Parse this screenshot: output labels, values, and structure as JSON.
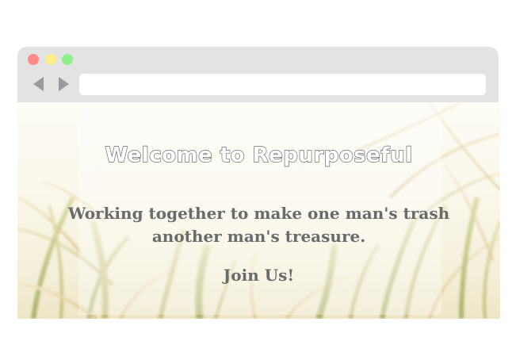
{
  "browser": {
    "address_bar": {
      "value": "",
      "placeholder": ""
    },
    "window_buttons": [
      "close",
      "minimize",
      "maximize"
    ],
    "nav_icons": [
      "back-arrow-icon",
      "forward-arrow-icon"
    ]
  },
  "page": {
    "heading": "Welcome to Repurposeful",
    "tagline": "Working together to make one man's trash another man's treasure.",
    "join_link": "Join Us!"
  },
  "colors": {
    "chrome": "#e3e3e3",
    "close_dot": "#ff8a87",
    "minimize_dot": "#ffef8a",
    "maximize_dot": "#8ef08a",
    "text": "#6a6a6a"
  }
}
